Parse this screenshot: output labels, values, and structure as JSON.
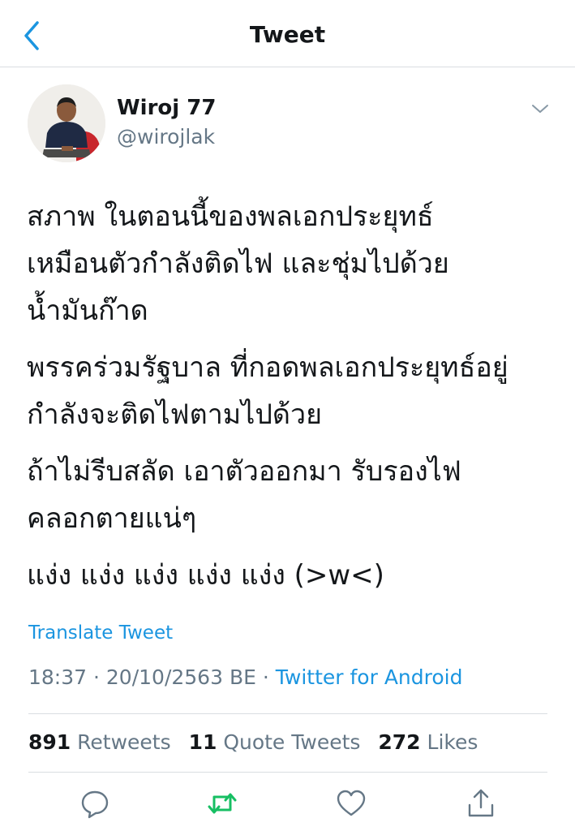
{
  "header": {
    "title": "Tweet"
  },
  "tweet": {
    "author_name": "Wiroj 77",
    "author_handle": "@wirojlak",
    "paragraphs": [
      {
        "lines": [
          "สภาพ ในตอนนี้ของพลเอกประยุทธ์",
          "เหมือนตัวกำลังติดไฟ และชุ่มไปด้วย",
          "น้ำมันก๊าด"
        ]
      },
      {
        "lines": [
          "พรรคร่วมรัฐบาล ที่กอดพลเอกประยุทธ์อยู่",
          "กำลังจะติดไฟตามไปด้วย"
        ]
      },
      {
        "lines": [
          "ถ้าไม่รีบสลัด เอาตัวออกมา รับรองไฟ",
          "คลอกตายแน่ๆ"
        ]
      },
      {
        "lines": [
          "แง่ง แง่ง แง่ง แง่ง แง่ง (>w<)"
        ]
      }
    ],
    "translate_label": "Translate Tweet",
    "time": "18:37",
    "date": "20/10/2563 BE",
    "source": "Twitter for Android",
    "separator": "·"
  },
  "stats": {
    "retweets_count": "891",
    "retweets_label": "Retweets",
    "quotes_count": "11",
    "quotes_label": "Quote Tweets",
    "likes_count": "272",
    "likes_label": "Likes"
  },
  "actions": [
    "reply-icon",
    "retweet-icon",
    "like-icon",
    "share-icon"
  ],
  "colors": {
    "accent": "#1b95e0",
    "retweet_green": "#17bf63",
    "text": "#14171a",
    "secondary": "#657786",
    "divider": "#d9dde1"
  }
}
